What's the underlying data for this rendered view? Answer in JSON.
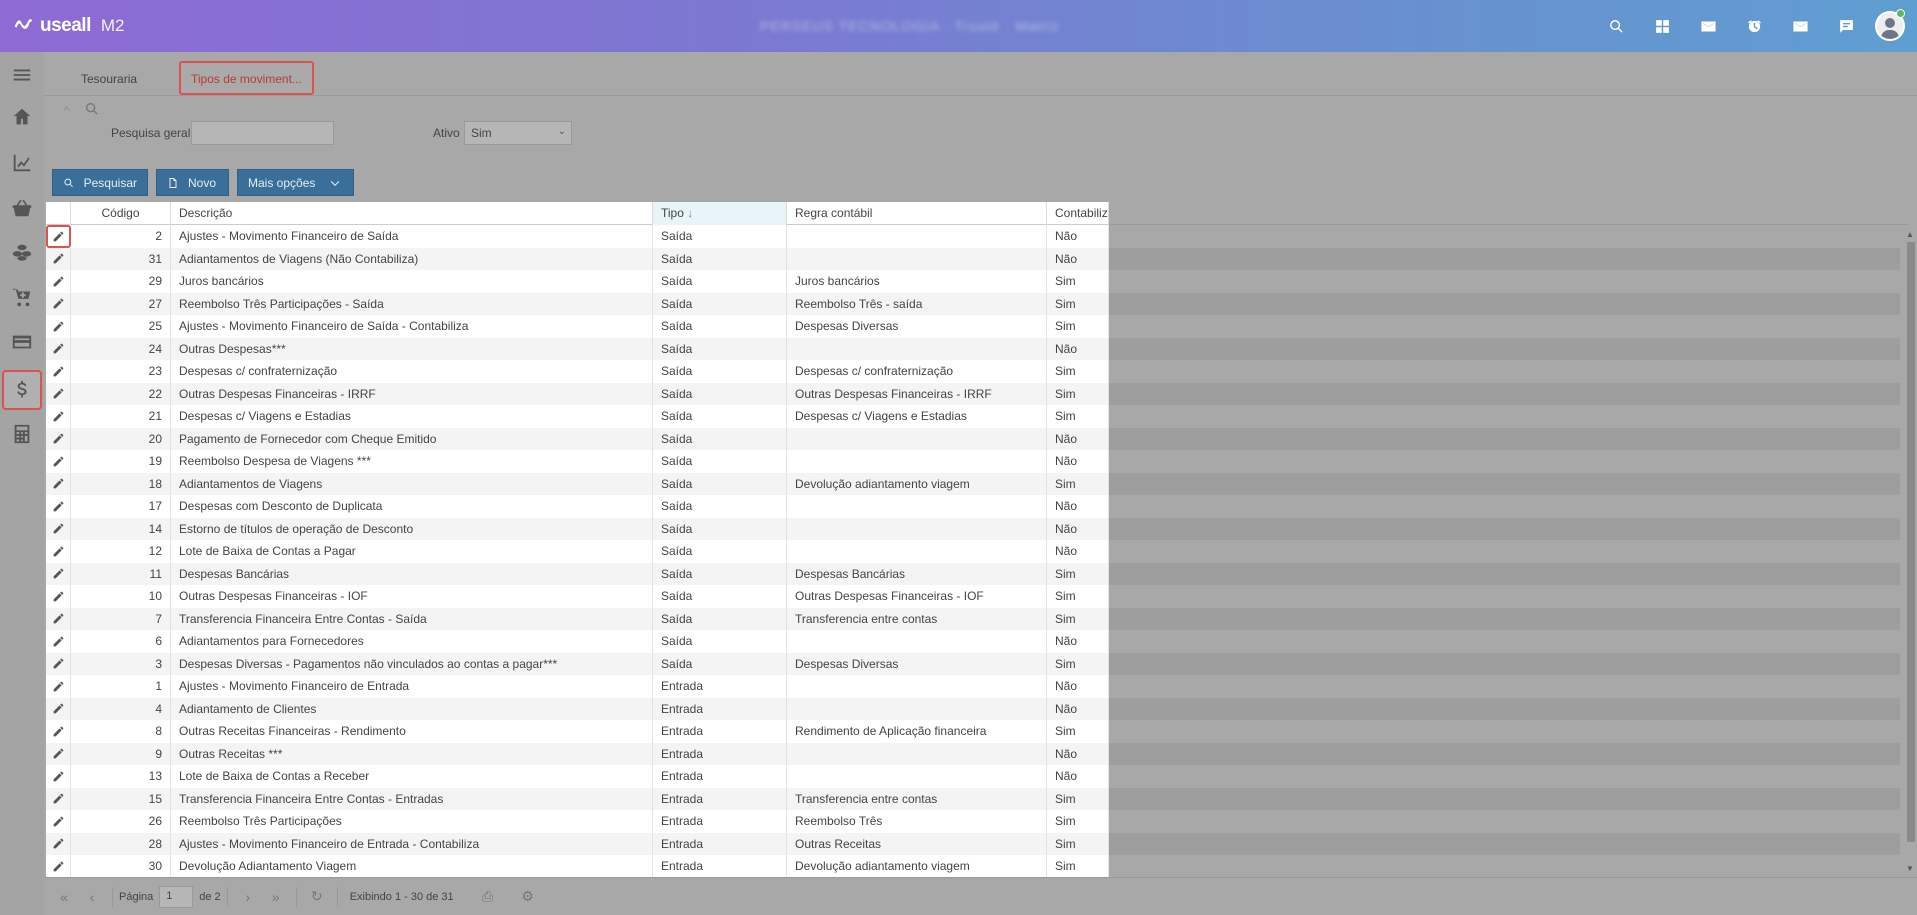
{
  "app": {
    "logo_text": "useall",
    "logo_suffix": "M2",
    "company_name": "PERSEUS TECNOLOGIA · Trusté · Matriz"
  },
  "topbar": {
    "icons": [
      "search-icon",
      "apps-icon",
      "mail-icon",
      "alarm-icon",
      "mail-icon",
      "chat-icon"
    ]
  },
  "sidebar": {
    "items": [
      "menu-icon",
      "home-icon",
      "chart-icon",
      "basket-icon",
      "coins-icon",
      "cart-add-icon",
      "card-icon",
      "dollar-icon",
      "calculator-icon"
    ]
  },
  "tabs": [
    {
      "label": "Tesouraria"
    },
    {
      "label": "Tipos de moviment..."
    }
  ],
  "filter": {
    "search_label": "Pesquisa geral",
    "search_value": "",
    "ativo_label": "Ativo",
    "ativo_value": "Sim"
  },
  "toolbar": {
    "search_label": "Pesquisar",
    "new_label": "Novo",
    "more_label": "Mais opções"
  },
  "grid": {
    "columns": {
      "codigo": "Código",
      "descricao": "Descrição",
      "tipo": "Tipo",
      "regra": "Regra contábil",
      "contabiliza": "Contabiliza"
    },
    "rows": [
      {
        "codigo": "2",
        "descricao": "Ajustes - Movimento Financeiro de Saída",
        "tipo": "Saída",
        "regra": "",
        "contabiliza": "Não"
      },
      {
        "codigo": "31",
        "descricao": "Adiantamentos de Viagens (Não Contabiliza)",
        "tipo": "Saída",
        "regra": "",
        "contabiliza": "Não"
      },
      {
        "codigo": "29",
        "descricao": "Juros bancários",
        "tipo": "Saída",
        "regra": "Juros bancários",
        "contabiliza": "Sim"
      },
      {
        "codigo": "27",
        "descricao": "Reembolso Três Participações - Saída",
        "tipo": "Saída",
        "regra": "Reembolso Três - saída",
        "contabiliza": "Sim"
      },
      {
        "codigo": "25",
        "descricao": "Ajustes - Movimento Financeiro de Saída - Contabiliza",
        "tipo": "Saída",
        "regra": "Despesas Diversas",
        "contabiliza": "Sim"
      },
      {
        "codigo": "24",
        "descricao": "Outras Despesas***",
        "tipo": "Saída",
        "regra": "",
        "contabiliza": "Não"
      },
      {
        "codigo": "23",
        "descricao": "Despesas c/ confraternização",
        "tipo": "Saída",
        "regra": "Despesas c/ confraternização",
        "contabiliza": "Sim"
      },
      {
        "codigo": "22",
        "descricao": "Outras Despesas Financeiras - IRRF",
        "tipo": "Saída",
        "regra": "Outras Despesas Financeiras - IRRF",
        "contabiliza": "Sim"
      },
      {
        "codigo": "21",
        "descricao": "Despesas c/ Viagens e Estadias",
        "tipo": "Saída",
        "regra": "Despesas c/ Viagens e Estadias",
        "contabiliza": "Sim"
      },
      {
        "codigo": "20",
        "descricao": "Pagamento de Fornecedor com Cheque Emitido",
        "tipo": "Saída",
        "regra": "",
        "contabiliza": "Não"
      },
      {
        "codigo": "19",
        "descricao": "Reembolso Despesa de Viagens ***",
        "tipo": "Saída",
        "regra": "",
        "contabiliza": "Não"
      },
      {
        "codigo": "18",
        "descricao": "Adiantamentos de Viagens",
        "tipo": "Saída",
        "regra": "Devolução adiantamento viagem",
        "contabiliza": "Sim"
      },
      {
        "codigo": "17",
        "descricao": "Despesas com Desconto de Duplicata",
        "tipo": "Saída",
        "regra": "",
        "contabiliza": "Não"
      },
      {
        "codigo": "14",
        "descricao": "Estorno de títulos de operação de Desconto",
        "tipo": "Saída",
        "regra": "",
        "contabiliza": "Não"
      },
      {
        "codigo": "12",
        "descricao": "Lote de Baixa de Contas a Pagar",
        "tipo": "Saída",
        "regra": "",
        "contabiliza": "Não"
      },
      {
        "codigo": "11",
        "descricao": "Despesas Bancárias",
        "tipo": "Saída",
        "regra": "Despesas Bancárias",
        "contabiliza": "Sim"
      },
      {
        "codigo": "10",
        "descricao": "Outras Despesas Financeiras - IOF",
        "tipo": "Saída",
        "regra": "Outras Despesas Financeiras - IOF",
        "contabiliza": "Sim"
      },
      {
        "codigo": "7",
        "descricao": "Transferencia Financeira Entre Contas - Saída",
        "tipo": "Saída",
        "regra": "Transferencia entre contas",
        "contabiliza": "Sim"
      },
      {
        "codigo": "6",
        "descricao": "Adiantamentos para Fornecedores",
        "tipo": "Saída",
        "regra": "",
        "contabiliza": "Não"
      },
      {
        "codigo": "3",
        "descricao": "Despesas Diversas - Pagamentos não vinculados ao contas a pagar***",
        "tipo": "Saída",
        "regra": "Despesas Diversas",
        "contabiliza": "Sim"
      },
      {
        "codigo": "1",
        "descricao": "Ajustes - Movimento Financeiro de Entrada",
        "tipo": "Entrada",
        "regra": "",
        "contabiliza": "Não"
      },
      {
        "codigo": "4",
        "descricao": "Adiantamento de Clientes",
        "tipo": "Entrada",
        "regra": "",
        "contabiliza": "Não"
      },
      {
        "codigo": "8",
        "descricao": "Outras Receitas Financeiras - Rendimento",
        "tipo": "Entrada",
        "regra": "Rendimento de Aplicação financeira",
        "contabiliza": "Sim"
      },
      {
        "codigo": "9",
        "descricao": "Outras Receitas ***",
        "tipo": "Entrada",
        "regra": "",
        "contabiliza": "Não"
      },
      {
        "codigo": "13",
        "descricao": "Lote de Baixa de Contas a Receber",
        "tipo": "Entrada",
        "regra": "",
        "contabiliza": "Não"
      },
      {
        "codigo": "15",
        "descricao": "Transferencia Financeira Entre Contas - Entradas",
        "tipo": "Entrada",
        "regra": "Transferencia entre contas",
        "contabiliza": "Sim"
      },
      {
        "codigo": "26",
        "descricao": "Reembolso Três Participações",
        "tipo": "Entrada",
        "regra": "Reembolso Três",
        "contabiliza": "Sim"
      },
      {
        "codigo": "28",
        "descricao": "Ajustes - Movimento Financeiro de Entrada - Contabiliza",
        "tipo": "Entrada",
        "regra": "Outras Receitas",
        "contabiliza": "Sim"
      },
      {
        "codigo": "30",
        "descricao": "Devolução Adiantamento Viagem",
        "tipo": "Entrada",
        "regra": "Devolução adiantamento viagem",
        "contabiliza": "Sim"
      }
    ]
  },
  "pager": {
    "page_label": "Página",
    "page_value": "1",
    "of_label": "de 2",
    "summary": "Exibindo 1 - 30 de 31"
  }
}
